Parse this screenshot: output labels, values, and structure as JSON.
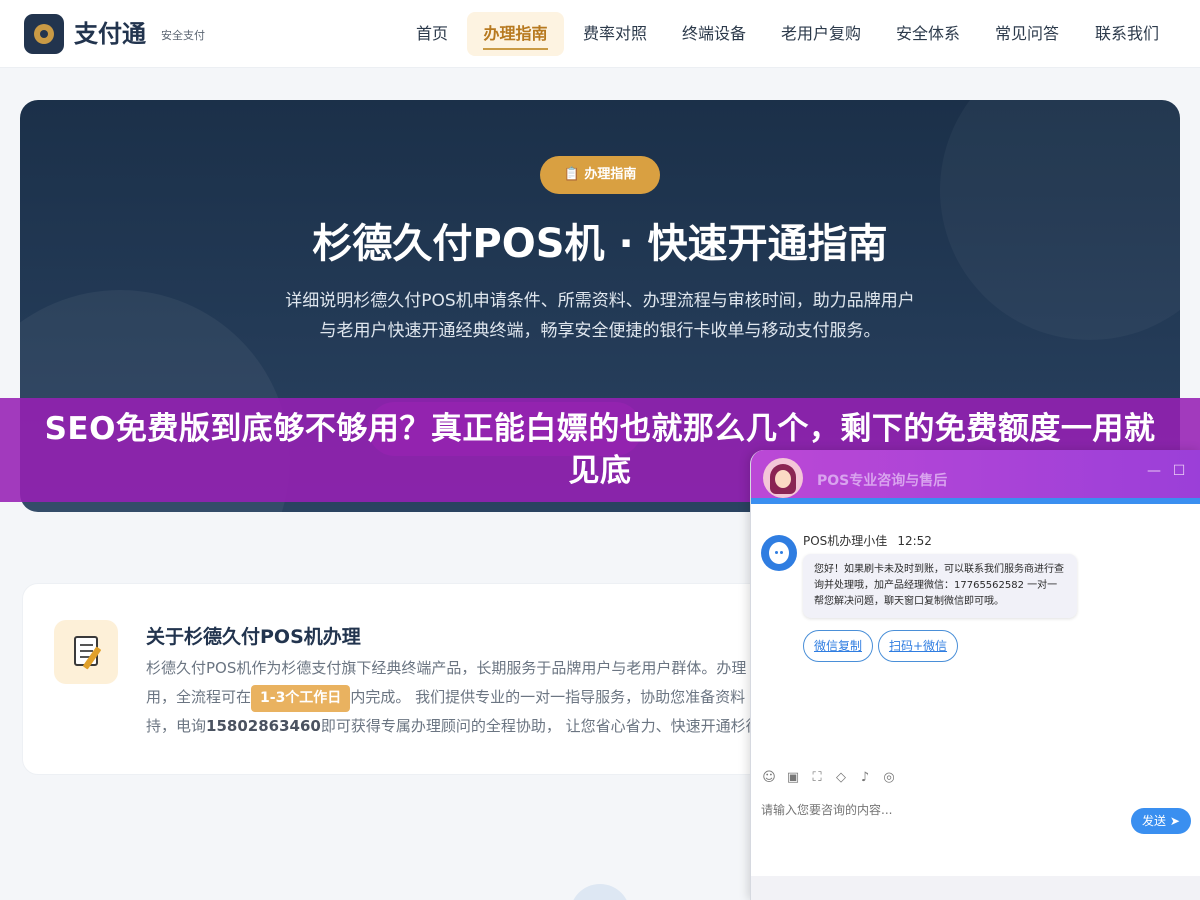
{
  "header": {
    "brand": "支付通",
    "brand_tag": "安全支付",
    "nav": [
      {
        "label": "首页"
      },
      {
        "label": "办理指南",
        "active": true
      },
      {
        "label": "费率对照"
      },
      {
        "label": "终端设备"
      },
      {
        "label": "老用户复购"
      },
      {
        "label": "安全体系"
      },
      {
        "label": "常见问答"
      },
      {
        "label": "联系我们"
      }
    ]
  },
  "hero": {
    "badge": "📋 办理指南",
    "title": "杉德久付POS机 · 快速开通指南",
    "description": "详细说明杉德久付POS机申请条件、所需资料、办理流程与审核时间，助力品牌用户与老用户快速开通经典终端，畅享安全便捷的银行卡收单与移动支付服务。"
  },
  "banner": {
    "text": "SEO免费版到底够不够用？真正能白嫖的也就那么几个，剩下的免费额度一用就见底"
  },
  "about": {
    "title": "关于杉德久付POS机办理",
    "line1": "杉德久付POS机作为杉德支付旗下经典终端产品，长期服务于品牌用户与老用户群体。办理",
    "line2_pre": "用，全流程可在",
    "line2_pill": "1-3个工作日",
    "line2_post": "内完成。 我们提供专业的一对一指导服务，协助您准备资料",
    "line3_pre": "持，电询",
    "phone": "15802863460",
    "line3_post": "即可获得专属办理顾问的全程协助， 让您省心省力、快速开通杉德"
  },
  "chat": {
    "title": "POS专业咨询与售后",
    "agent_name": "POS机办理小佳",
    "time": "12:52",
    "message": "您好！如果刷卡未及时到账，可以联系我们服务商进行查询并处理哦，加产品经理微信：17765562582 一对一帮您解决问题，聊天窗口复制微信即可哦。",
    "quick_buttons": [
      "微信复制",
      "扫码+微信"
    ],
    "input_placeholder": "请输入您要咨询的内容...",
    "send_label": "发送",
    "tools": [
      "smile-icon",
      "image-icon",
      "screenshot-icon",
      "shield-icon",
      "voice-icon",
      "wechat-icon"
    ]
  },
  "colors": {
    "brand_navy": "#22344e",
    "accent_gold": "#d9a041",
    "banner_purple": "#9620b4",
    "chat_blue": "#3a8ff0"
  }
}
